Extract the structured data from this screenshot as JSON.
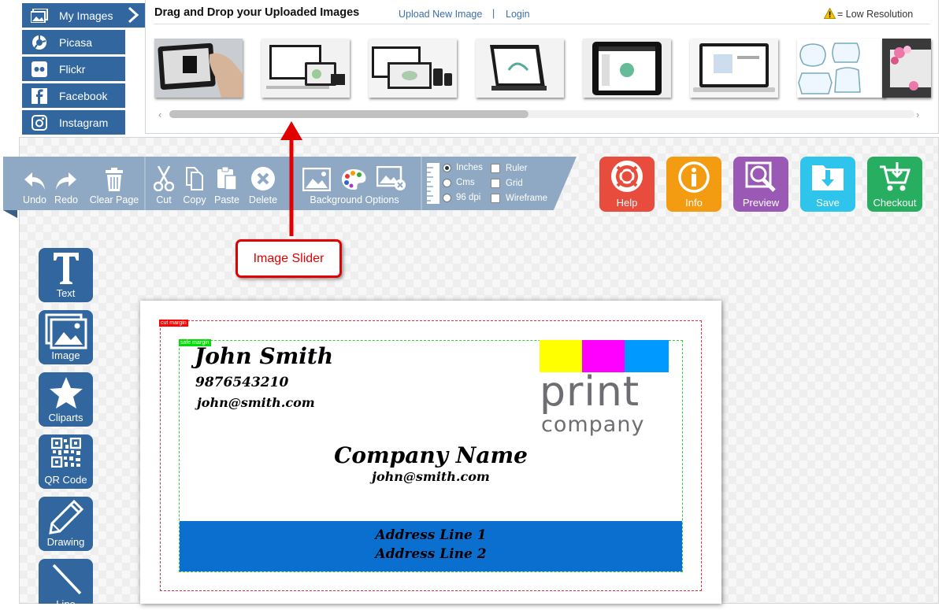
{
  "sources": [
    {
      "label": "My Images",
      "icon": "images-icon"
    },
    {
      "label": "Picasa",
      "icon": "picasa-icon"
    },
    {
      "label": "Flickr",
      "icon": "flickr-icon"
    },
    {
      "label": "Facebook",
      "icon": "facebook-icon"
    },
    {
      "label": "Instagram",
      "icon": "instagram-icon"
    }
  ],
  "gallery": {
    "title": "Drag and Drop your Uploaded Images",
    "upload_link": "Upload New Image",
    "separator": "|",
    "login_link": "Login",
    "low_res_label": "= Low Resolution",
    "thumbnails": [
      "tablet-hand",
      "devices-laptop-tablet",
      "devices-laptop-phone",
      "tablet-stand",
      "tablet-screen",
      "laptop-screen",
      "frames-blue",
      "frame-flowers"
    ]
  },
  "toolbar": {
    "undo": "Undo",
    "redo": "Redo",
    "clear": "Clear Page",
    "cut": "Cut",
    "copy": "Copy",
    "paste": "Paste",
    "delete": "Delete",
    "background": "Background Options",
    "units": [
      "Inches",
      "Cms",
      "96 dpi"
    ],
    "selected_unit": "Inches",
    "toggles": [
      "Ruler",
      "Grid",
      "Wireframe"
    ]
  },
  "actions": [
    {
      "label": "Help",
      "color": "#e84c3d"
    },
    {
      "label": "Info",
      "color": "#f39c12"
    },
    {
      "label": "Preview",
      "color": "#9b59b6"
    },
    {
      "label": "Save",
      "color": "#2ec4ec"
    },
    {
      "label": "Checkout",
      "color": "#27ae60"
    }
  ],
  "tools": [
    "Text",
    "Image",
    "Cliparts",
    "QR Code",
    "Drawing",
    "Line"
  ],
  "annotation": {
    "label": "Image Slider",
    "color": "#e00000"
  },
  "card": {
    "cut_margin": "cut margin",
    "safe_margin": "safe margin",
    "name": "John Smith",
    "phone": "9876543210",
    "email": "john@smith.com",
    "company": "Company Name",
    "company_email": "john@smith.com",
    "address1": "Address Line 1",
    "address2": "Address Line 2",
    "logo_word1": "print",
    "logo_word2": "company",
    "logo_colors": [
      "#ffff00",
      "#ff00ff",
      "#0099ff"
    ],
    "band_color": "#0b6fd0"
  }
}
